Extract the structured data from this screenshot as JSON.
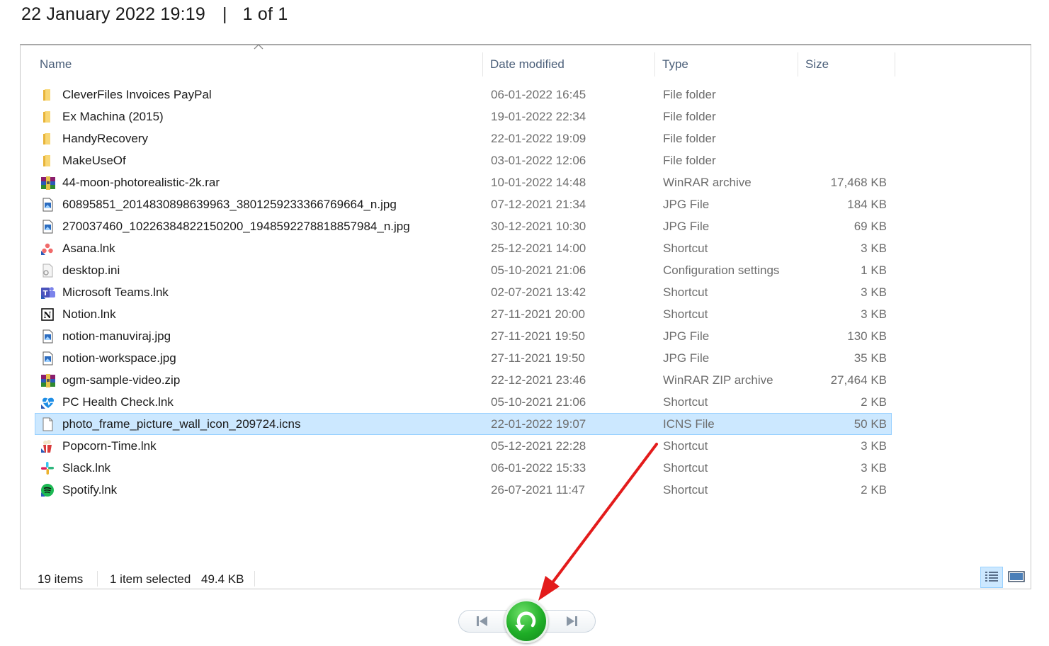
{
  "header": {
    "date": "22 January 2022 19:19",
    "separator": "|",
    "page_counter": "1 of 1"
  },
  "columns": {
    "name": "Name",
    "date": "Date modified",
    "type": "Type",
    "size": "Size"
  },
  "files": [
    {
      "name": "CleverFiles Invoices PayPal",
      "date": "06-01-2022 16:45",
      "type": "File folder",
      "size": "",
      "icon": "folder-icon"
    },
    {
      "name": "Ex Machina (2015)",
      "date": "19-01-2022 22:34",
      "type": "File folder",
      "size": "",
      "icon": "folder-icon"
    },
    {
      "name": "HandyRecovery",
      "date": "22-01-2022 19:09",
      "type": "File folder",
      "size": "",
      "icon": "folder-icon"
    },
    {
      "name": "MakeUseOf",
      "date": "03-01-2022 12:06",
      "type": "File folder",
      "size": "",
      "icon": "folder-icon"
    },
    {
      "name": "44-moon-photorealistic-2k.rar",
      "date": "10-01-2022 14:48",
      "type": "WinRAR archive",
      "size": "17,468 KB",
      "icon": "winrar-icon"
    },
    {
      "name": "60895851_2014830898639963_3801259233366769664_n.jpg",
      "date": "07-12-2021 21:34",
      "type": "JPG File",
      "size": "184 KB",
      "icon": "image-file-icon"
    },
    {
      "name": "270037460_10226384822150200_1948592278818857984_n.jpg",
      "date": "30-12-2021 10:30",
      "type": "JPG File",
      "size": "69 KB",
      "icon": "image-file-icon"
    },
    {
      "name": "Asana.lnk",
      "date": "25-12-2021 14:00",
      "type": "Shortcut",
      "size": "3 KB",
      "icon": "asana-icon"
    },
    {
      "name": "desktop.ini",
      "date": "05-10-2021 21:06",
      "type": "Configuration settings",
      "size": "1 KB",
      "icon": "settings-file-icon"
    },
    {
      "name": "Microsoft Teams.lnk",
      "date": "02-07-2021 13:42",
      "type": "Shortcut",
      "size": "3 KB",
      "icon": "teams-icon"
    },
    {
      "name": "Notion.lnk",
      "date": "27-11-2021 20:00",
      "type": "Shortcut",
      "size": "3 KB",
      "icon": "notion-icon"
    },
    {
      "name": "notion-manuviraj.jpg",
      "date": "27-11-2021 19:50",
      "type": "JPG File",
      "size": "130 KB",
      "icon": "image-file-icon"
    },
    {
      "name": "notion-workspace.jpg",
      "date": "27-11-2021 19:50",
      "type": "JPG File",
      "size": "35 KB",
      "icon": "image-file-icon"
    },
    {
      "name": "ogm-sample-video.zip",
      "date": "22-12-2021 23:46",
      "type": "WinRAR ZIP archive",
      "size": "27,464 KB",
      "icon": "winrar-icon"
    },
    {
      "name": "PC Health Check.lnk",
      "date": "05-10-2021 21:06",
      "type": "Shortcut",
      "size": "2 KB",
      "icon": "health-check-icon"
    },
    {
      "name": "photo_frame_picture_wall_icon_209724.icns",
      "date": "22-01-2022 19:07",
      "type": "ICNS File",
      "size": "50 KB",
      "icon": "blank-file-icon",
      "selected": true
    },
    {
      "name": "Popcorn-Time.lnk",
      "date": "05-12-2021 22:28",
      "type": "Shortcut",
      "size": "3 KB",
      "icon": "popcorn-icon"
    },
    {
      "name": "Slack.lnk",
      "date": "06-01-2022 15:33",
      "type": "Shortcut",
      "size": "3 KB",
      "icon": "slack-icon"
    },
    {
      "name": "Spotify.lnk",
      "date": "26-07-2021 11:47",
      "type": "Shortcut",
      "size": "2 KB",
      "icon": "spotify-icon"
    }
  ],
  "status": {
    "items_count": "19 items",
    "selected": "1 item selected",
    "selected_size": "49.4 KB"
  },
  "colors": {
    "selection": "#cce8ff",
    "rotate_button": "#1fae27",
    "annotation_arrow": "#e31b1b"
  }
}
